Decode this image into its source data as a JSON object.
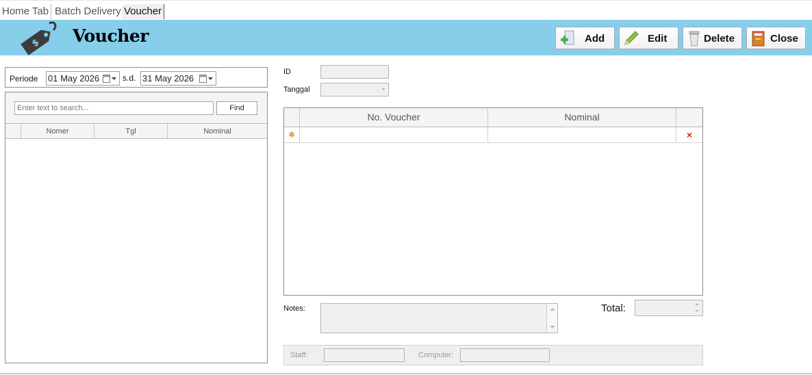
{
  "tabs": [
    {
      "label": "Home Tab",
      "active": false
    },
    {
      "label": "Batch Delivery",
      "active": false
    },
    {
      "label": "Voucher",
      "active": true
    }
  ],
  "header": {
    "title": "Voucher",
    "icon": "price-tag-icon",
    "background": "#87ceeb",
    "buttons": {
      "add": {
        "label": "Add",
        "icon": "add-document-icon"
      },
      "edit": {
        "label": "Edit",
        "icon": "pencil-icon"
      },
      "delete": {
        "label": "Delete",
        "icon": "trash-can-icon"
      },
      "close": {
        "label": "Close",
        "icon": "exit-door-icon"
      }
    }
  },
  "left_panel": {
    "periode_label": "Periode",
    "date_from": "01 May 2026",
    "sd_label": "s.d.",
    "date_to": "31 May  2026",
    "search_placeholder": "Enter text to search...",
    "find_label": "Find",
    "columns": [
      "Nomer",
      "Tgl",
      "Nominal"
    ],
    "rows": []
  },
  "form": {
    "id_label": "ID",
    "id_value": "",
    "tanggal_label": "Tanggal",
    "tanggal_value": "",
    "detail_columns": [
      "No. Voucher",
      "Nominal"
    ],
    "new_row_marker": "✱",
    "delete_marker": "×",
    "notes_label": "Notes:",
    "notes_value": "",
    "total_label": "Total:",
    "total_value": "",
    "staff_label": "Staff:",
    "staff_value": "",
    "computer_label": "Computer:",
    "computer_value": ""
  }
}
